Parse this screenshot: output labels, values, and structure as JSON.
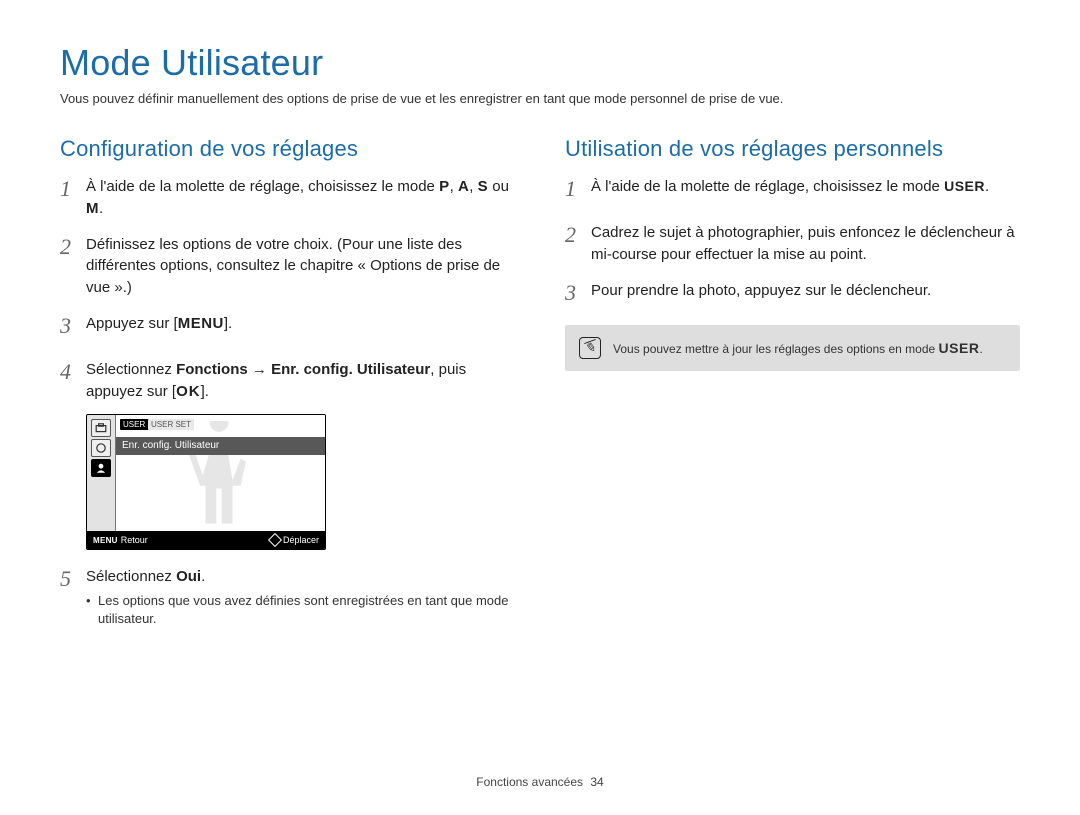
{
  "title": "Mode Utilisateur",
  "lead": "Vous pouvez définir manuellement des options de prise de vue et les enregistrer en tant que mode personnel de prise de vue.",
  "left": {
    "heading": "Configuration de vos réglages",
    "step1_a": "À l'aide de la molette de réglage, choisissez le mode ",
    "step1_p": "P",
    "step1_b": ", ",
    "step1_A": "A",
    "step1_c": ", ",
    "step1_S": "S",
    "step1_d": " ou ",
    "step1_M": "M",
    "step1_e": ".",
    "step2": "Définissez les options de votre choix. (Pour une liste des différentes options, consultez le chapitre « Options de prise de vue ».)",
    "step3_a": "Appuyez sur [",
    "step3_menu": "MENU",
    "step3_b": "].",
    "step4_a": "Sélectionnez ",
    "step4_fn": "Fonctions",
    "step4_arrow": " → ",
    "step4_ec": "Enr. config. Utilisateur",
    "step4_b": ", puis appuyez sur [",
    "step4_ok": "OK",
    "step4_c": "].",
    "step5_a": "Sélectionnez ",
    "step5_oui": "Oui",
    "step5_b": ".",
    "step5_sub": "Les options que vous avez définies sont enregistrées en tant que mode utilisateur."
  },
  "screen": {
    "tab1": "USER\nSET",
    "tab2": "USER\nSET",
    "caption": "Enr. config. Utilisateur",
    "menu": "MENU",
    "back": "Retour",
    "move": "Déplacer"
  },
  "right": {
    "heading": "Utilisation de vos réglages personnels",
    "step1_a": "À l'aide de la molette de réglage, choisissez le mode ",
    "step1_user": "USER",
    "step1_b": ".",
    "step2": "Cadrez le sujet à photographier, puis enfoncez le déclencheur à mi-course pour effectuer la mise au point.",
    "step3": "Pour prendre la photo, appuyez sur le déclencheur.",
    "note_a": "Vous pouvez mettre à jour les réglages des options en mode ",
    "note_user": "USER",
    "note_b": "."
  },
  "footer": {
    "section": "Fonctions avancées",
    "page": "34"
  },
  "nums": {
    "n1": "1",
    "n2": "2",
    "n3": "3",
    "n4": "4",
    "n5": "5"
  }
}
